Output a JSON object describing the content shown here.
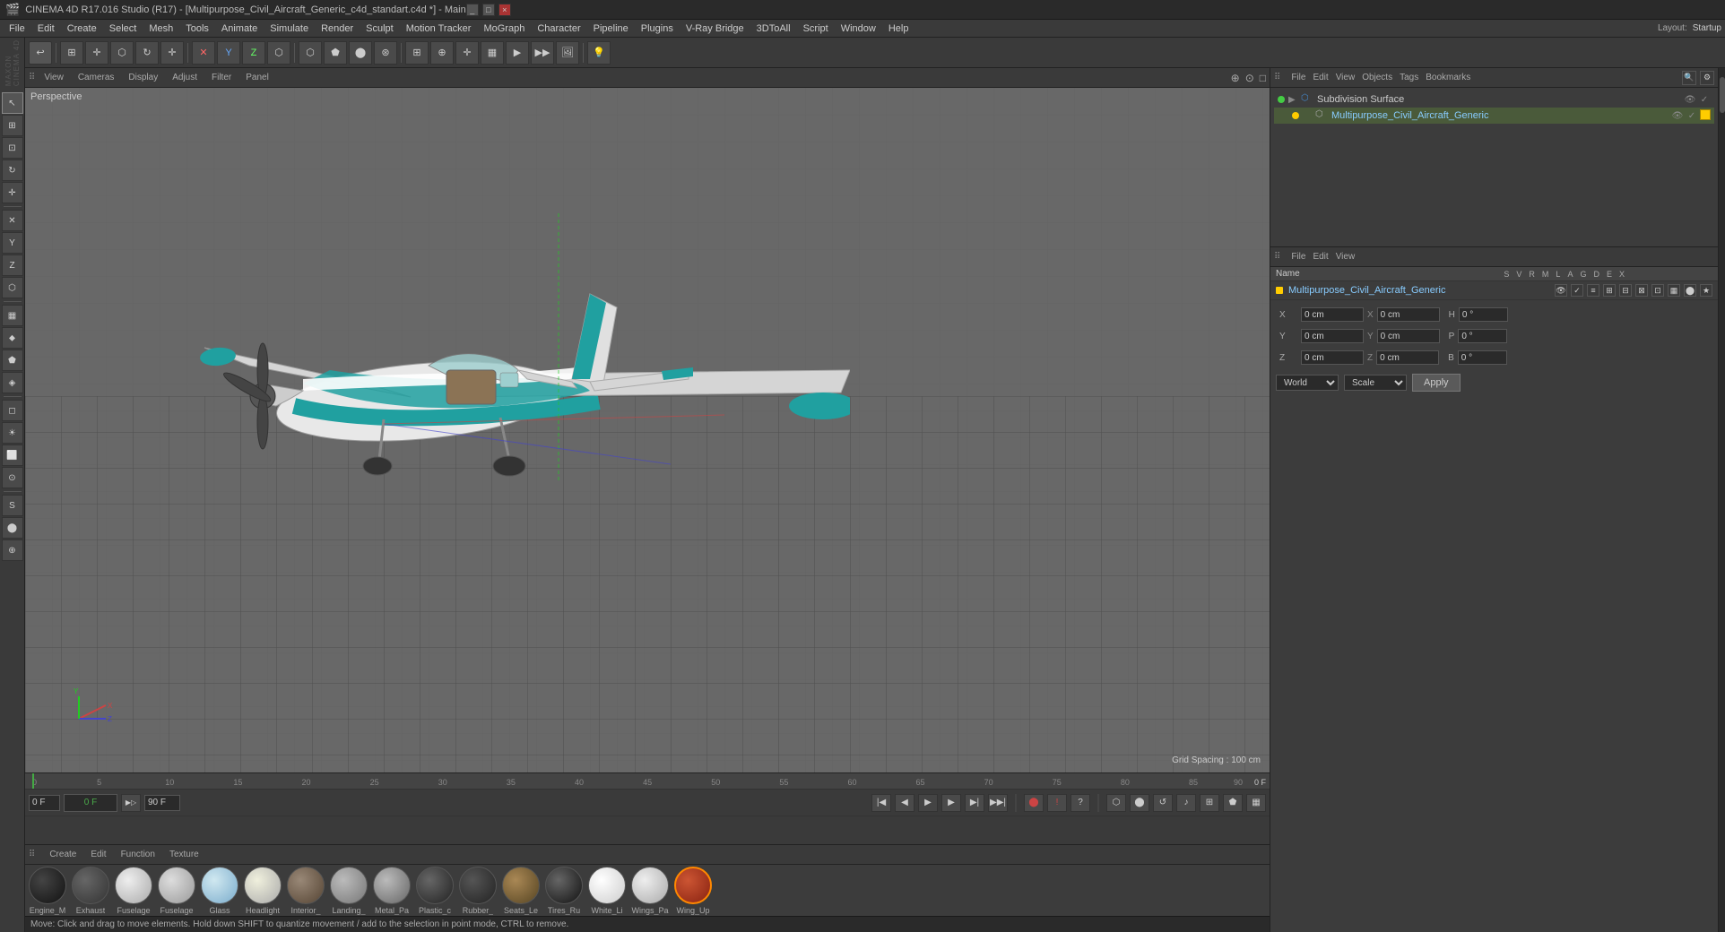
{
  "titlebar": {
    "title": "CINEMA 4D R17.016 Studio (R17) - [Multipurpose_Civil_Aircraft_Generic_c4d_standart.c4d *] - Main",
    "controls": [
      "_",
      "□",
      "×"
    ]
  },
  "menubar": {
    "items": [
      "File",
      "Edit",
      "Create",
      "Select",
      "Mesh",
      "Tools",
      "Animate",
      "Simulate",
      "Render",
      "Sculpt",
      "Motion Tracker",
      "MoGraph",
      "Character",
      "Pipeline",
      "Plugins",
      "V-Ray Bridge",
      "3DToAll",
      "Script",
      "Window",
      "Help"
    ]
  },
  "layout_label": "Layout:",
  "layout_value": "Startup",
  "viewport": {
    "label": "Perspective",
    "tabs": [
      "View",
      "Cameras",
      "Display",
      "Adjust",
      "Filter",
      "Panel"
    ],
    "grid_spacing": "Grid Spacing : 100 cm",
    "corner_icons": [
      "◈",
      "⊕",
      "□"
    ]
  },
  "object_manager": {
    "toolbar_items": [
      "File",
      "Edit",
      "View",
      "Objects",
      "Tags",
      "Bookmarks"
    ],
    "objects": [
      {
        "name": "Subdivision Surface",
        "dot_color": "#44cc44",
        "indent": 0,
        "expanded": true
      },
      {
        "name": "Multipurpose_Civil_Aircraft_Generic",
        "dot_color": "#ffcc00",
        "indent": 1,
        "expanded": false
      }
    ]
  },
  "attributes_manager": {
    "toolbar_items": [
      "File",
      "Edit",
      "View"
    ],
    "object_name": "Multipurpose_Civil_Aircraft_Generic",
    "columns": [
      "Name",
      "S",
      "V",
      "R",
      "M",
      "L",
      "A",
      "G",
      "D",
      "E",
      "X"
    ],
    "fields": {
      "X": {
        "label": "X",
        "value1": "0 cm",
        "eq": "X",
        "value2": "0 cm",
        "h_label": "H",
        "h_value": "0°"
      },
      "Y": {
        "label": "Y",
        "value1": "0 cm",
        "eq": "Y",
        "value2": "0 cm",
        "p_label": "P",
        "p_value": "0°"
      },
      "Z": {
        "label": "Z",
        "value1": "0 cm",
        "eq": "Z",
        "value2": "0 cm",
        "b_label": "B",
        "b_value": "0°"
      }
    }
  },
  "transform": {
    "world_label": "World",
    "scale_label": "Scale",
    "apply_label": "Apply"
  },
  "timeline": {
    "start_frame": "0 F",
    "current_frame": "0 F",
    "end_frame": "90 F",
    "ruler_marks": [
      0,
      5,
      10,
      15,
      20,
      25,
      30,
      35,
      40,
      45,
      50,
      55,
      60,
      65,
      70,
      75,
      80,
      85,
      90
    ]
  },
  "materials": {
    "toolbar_items": [
      "Create",
      "Edit",
      "Function",
      "Texture"
    ],
    "items": [
      {
        "name": "Engine_M",
        "color": "#222222"
      },
      {
        "name": "Exhaust",
        "color": "#4a4a4a"
      },
      {
        "name": "Fuselage",
        "color": "#cccccc"
      },
      {
        "name": "Fuselage",
        "color": "#b8b8b8"
      },
      {
        "name": "Glass",
        "color": "#c8d8e0"
      },
      {
        "name": "Headlight",
        "color": "#ddddcc"
      },
      {
        "name": "Interior_",
        "color": "#888877"
      },
      {
        "name": "Landing_",
        "color": "#aaaaaa"
      },
      {
        "name": "Metal_Pa",
        "color": "#999999"
      },
      {
        "name": "Plastic_c",
        "color": "#444444"
      },
      {
        "name": "Rubber_",
        "color": "#333333"
      },
      {
        "name": "Seats_Le",
        "color": "#8b7355"
      },
      {
        "name": "Tires_Ru",
        "color": "#444444"
      },
      {
        "name": "White_Li",
        "color": "#eeeeee"
      },
      {
        "name": "Wings_Pa",
        "color": "#dddddd"
      },
      {
        "name": "Wing_Up",
        "color": "#8b3a3a",
        "selected": true
      }
    ]
  },
  "statusbar": {
    "message": "Move: Click and drag to move elements. Hold down SHIFT to quantize movement / add to the selection in point mode, CTRL to remove."
  },
  "icons": {
    "move": "✛",
    "scale": "⊞",
    "rotate": "↻",
    "select": "▣",
    "camera": "📷",
    "render": "▶",
    "play": "▶",
    "stop": "■",
    "rewind": "◀◀",
    "forward": "▶▶"
  }
}
